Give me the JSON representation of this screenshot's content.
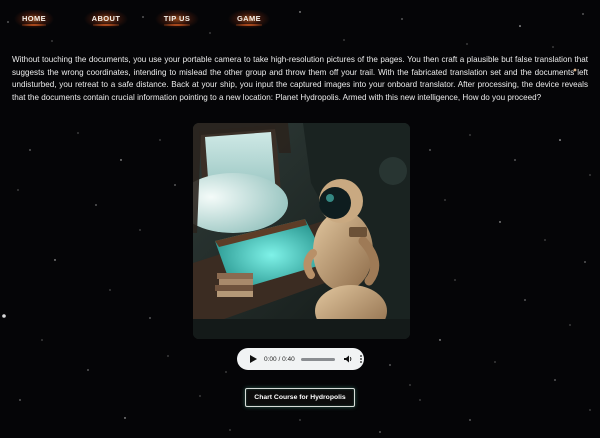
{
  "nav": {
    "items": [
      {
        "label": "HOME"
      },
      {
        "label": "ABOUT"
      },
      {
        "label": "TIP US"
      },
      {
        "label": "GAME"
      }
    ]
  },
  "story": {
    "text": "Without touching the documents, you use your portable camera to take high-resolution pictures of the pages. You then craft a plausible but false translation that suggests the wrong coordinates, intending to mislead the other group and throw them off your trail. With the fabricated translation set and the documents left undisturbed, you retreat to a safe distance. Back at your ship, you input the captured images into your onboard translator. After processing, the device reveals that the documents contain crucial information pointing to a new location: Planet Hydropolis. Armed with this new intelligence, How do you proceed?"
  },
  "audio": {
    "time": "0:00 / 0:40",
    "progress": 0
  },
  "cta": {
    "label": "Chart Course for Hydropolis"
  },
  "icons": {
    "play": "play-icon",
    "volume": "volume-icon",
    "more": "more-vertical-icon"
  }
}
